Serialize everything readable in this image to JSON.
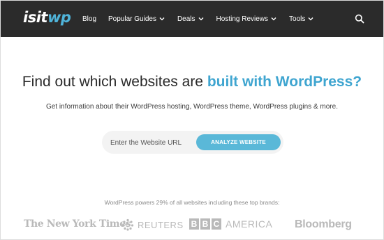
{
  "logo": {
    "text_main": "isit",
    "text_accent": "wp"
  },
  "nav": {
    "items": [
      {
        "label": "Blog",
        "has_dropdown": false
      },
      {
        "label": "Popular Guides",
        "has_dropdown": true
      },
      {
        "label": "Deals",
        "has_dropdown": true
      },
      {
        "label": "Hosting Reviews",
        "has_dropdown": true
      },
      {
        "label": "Tools",
        "has_dropdown": true
      }
    ],
    "search_icon": "search-icon"
  },
  "hero": {
    "headline_plain": "Find out which websites are ",
    "headline_accent": "built with WordPress?",
    "subline": "Get information about their WordPress hosting, WordPress theme, WordPress plugins & more.",
    "url_placeholder": "Enter the Website URL",
    "analyze_label": "ANALYZE WEBSITE"
  },
  "brands": {
    "caption": "WordPress powers 29% of all websites including these top brands:",
    "nyt": "The New York Times",
    "reuters": "REUTERS",
    "bbc_letters": [
      "B",
      "B",
      "C"
    ],
    "bbc_suffix": "AMERICA",
    "bloomberg": "Bloomberg"
  },
  "colors": {
    "navbar_bg": "#2b2b2b",
    "accent": "#3fa5d0",
    "button_bg": "#5ab8d8",
    "brand_gray": "#b9b9b9"
  }
}
